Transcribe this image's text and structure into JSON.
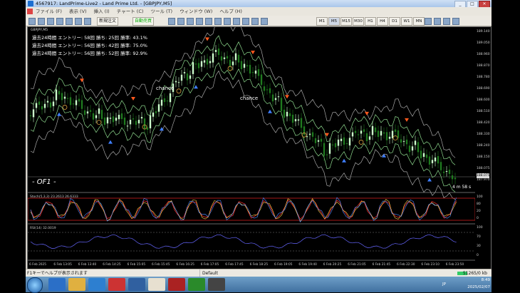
{
  "window": {
    "title": "4567917: LandPrime-Live2 - Land Prime Ltd. - [GBPJPY,M5]",
    "controls": [
      "_",
      "□",
      "✕"
    ]
  },
  "menu": [
    "ファイル (F)",
    "表示 (V)",
    "挿入 (I)",
    "チャート (C)",
    "ツール (T)",
    "ウィンドウ (W)",
    "ヘルプ (H)"
  ],
  "toolbar": {
    "new_order": "新規注文",
    "auto_trade": "自動売買",
    "timeframes": [
      "M1",
      "M5",
      "M15",
      "M30",
      "H1",
      "H4",
      "D1",
      "W1",
      "MN"
    ],
    "selected_timeframe": "M5"
  },
  "chart": {
    "symbol": "GBPJPY,M5",
    "stats": [
      {
        "period": "過去24時間",
        "entries": "エントリー: 58回",
        "wins": "勝ち: 25回",
        "rate": "勝率: 43.1%"
      },
      {
        "period": "過去24時間",
        "entries": "エントリー: 56回",
        "wins": "勝ち: 42回",
        "rate": "勝率: 75.0%"
      },
      {
        "period": "過去24時間",
        "entries": "エントリー: 56回",
        "wins": "勝ち: 52回",
        "rate": "勝率: 92.9%"
      }
    ],
    "brand": "- OF1 -",
    "countdown": "4 m 58 s",
    "chance_labels": [
      "chance",
      "chance"
    ],
    "current_price": "188.075",
    "price_ticks": [
      "189.140",
      "189.050",
      "188.960",
      "188.870",
      "188.780",
      "188.690",
      "188.600",
      "188.510",
      "188.420",
      "188.330",
      "188.240",
      "188.150",
      "188.075",
      "187.970"
    ],
    "stoch_label": "Stoch(5,3,3) 23.2613 26.6333",
    "stoch_ticks": [
      "100",
      "80",
      "20",
      "0"
    ],
    "rsi_label": "RSI(14) 32.0019",
    "rsi_ticks": [
      "100",
      "70",
      "30",
      "0"
    ],
    "time_labels": [
      "6 Feb 2025",
      "6 Feb 13:05",
      "6 Feb 13:40",
      "6 Feb 14:25",
      "6 Feb 15:05",
      "6 Feb 15:45",
      "6 Feb 16:25",
      "6 Feb 17:05",
      "6 Feb 17:45",
      "6 Feb 18:25",
      "6 Feb 19:05",
      "6 Feb 19:40",
      "6 Feb 20:25",
      "6 Feb 21:05",
      "6 Feb 21:45",
      "6 Feb 22:30",
      "6 Feb 23:10",
      "6 Feb 23:50"
    ]
  },
  "status": {
    "help": "F1キーでヘルプが表示されます",
    "profile": "Default",
    "traffic": "51265/0 kb"
  },
  "taskbar": {
    "time": "8:49",
    "date": "2025/02/07",
    "lang": "JP"
  },
  "colors": {
    "bull_candle": "#ccffcc",
    "bear_candle": "#1f7a1f",
    "sell_arrow": "#ff5a1e",
    "buy_arrow": "#3f7fff",
    "band_line": "#a8a8a8",
    "stoch_main": "#ff3030",
    "rsi_line": "#6666ff"
  }
}
